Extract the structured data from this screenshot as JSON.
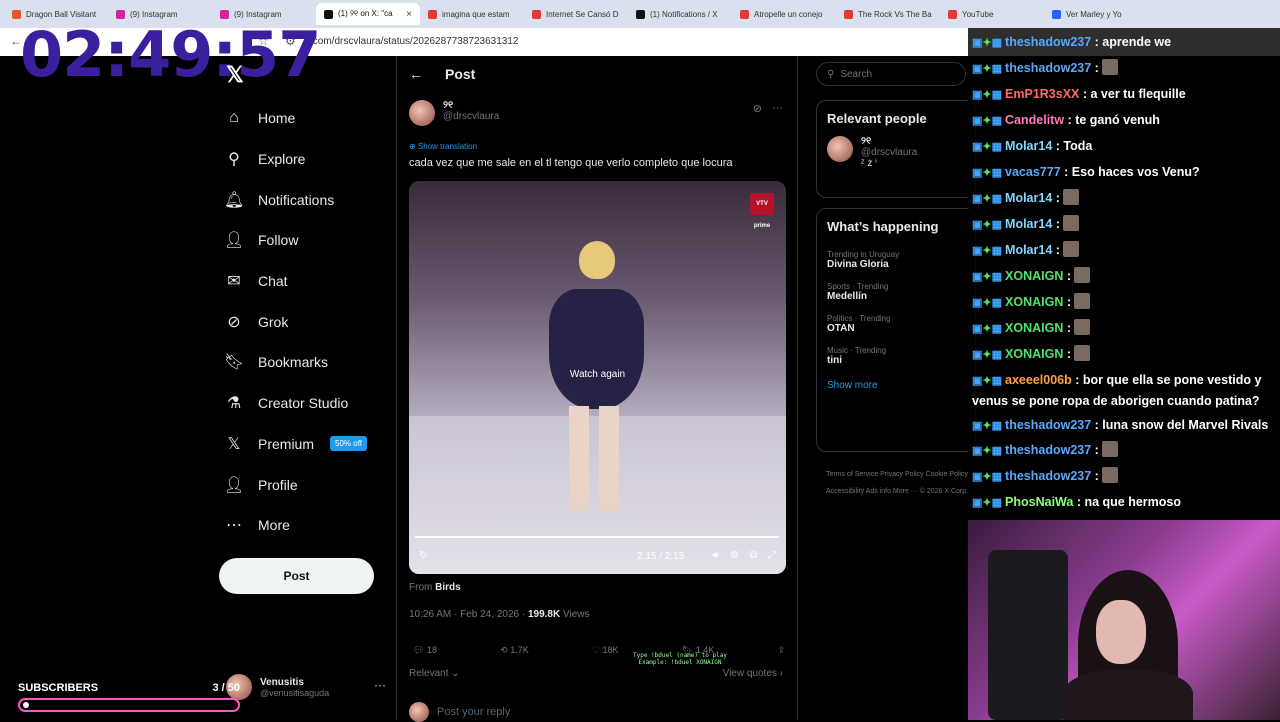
{
  "browser": {
    "tabs": [
      {
        "title": "Dragon Ball Visitant",
        "color": "#e8572a"
      },
      {
        "title": "(9) Instagram",
        "color": "#d6249f"
      },
      {
        "title": "(9) Instagram",
        "color": "#d6249f"
      },
      {
        "title": "(1) ୨୧ on X: \"ca",
        "color": "#111111",
        "active": true
      },
      {
        "title": "imagina que estam",
        "color": "#e53935"
      },
      {
        "title": "Internet Se Cansó D",
        "color": "#e53935"
      },
      {
        "title": "(1) Notifications / X",
        "color": "#111111"
      },
      {
        "title": "Atropelle un conejo",
        "color": "#e53935"
      },
      {
        "title": "The Rock Vs The Ba",
        "color": "#e53935"
      },
      {
        "title": "YouTube",
        "color": "#e53935"
      },
      {
        "title": "Ver Marley y Yo",
        "color": "#2962ff"
      }
    ],
    "url": "x.com/drscvlaura/status/2026287738723631312"
  },
  "stream": {
    "timer": "02:49:57",
    "subscribers_label": "SUBSCRIBERS",
    "subscribers_count": "3 / 50",
    "subscribers_fraction": 0.06
  },
  "sidebar": {
    "items": [
      {
        "label": "Home",
        "icon": "home-icon",
        "glyph": "⌂"
      },
      {
        "label": "Explore",
        "icon": "search-icon",
        "glyph": "⚲"
      },
      {
        "label": "Notifications",
        "icon": "bell-icon",
        "glyph": "🔔︎"
      },
      {
        "label": "Follow",
        "icon": "add-user-icon",
        "glyph": "👤︎"
      },
      {
        "label": "Chat",
        "icon": "mail-icon",
        "glyph": "✉"
      },
      {
        "label": "Grok",
        "icon": "grok-icon",
        "glyph": "⊘"
      },
      {
        "label": "Bookmarks",
        "icon": "bookmark-icon",
        "glyph": "🔖︎"
      },
      {
        "label": "Creator Studio",
        "icon": "flask-icon",
        "glyph": "⚗"
      },
      {
        "label": "Premium",
        "icon": "x-icon",
        "glyph": "𝕏"
      },
      {
        "label": "Profile",
        "icon": "person-icon",
        "glyph": "👤︎"
      },
      {
        "label": "More",
        "icon": "more-circle-icon",
        "glyph": "⋯"
      }
    ],
    "premium_badge": "50% off",
    "post_button": "Post",
    "account_name": "Venusitis",
    "account_handle": "@venusitisaguda"
  },
  "post": {
    "header": "Post",
    "author_name": "୨୧",
    "author_handle": "@drscvlaura",
    "show_translation": "Show translation",
    "text": "cada vez que me sale en el tl tengo que verlo completo que locura",
    "video_logo": "VTV prime",
    "watch_again": "Watch again",
    "video_time": "2:15 / 2:15",
    "from_label": "From",
    "from_source": "Birds",
    "timestamp": "10:26 AM · Feb 24, 2026 ·",
    "views_count": "199.8K",
    "views_label": "Views",
    "replies": "18",
    "reposts": "1.7K",
    "likes": "18K",
    "bookmarks": "1.4K",
    "sort_label": "Relevant",
    "view_quotes": "View quotes",
    "reply_placeholder": "Post your reply",
    "game_overlay_line1": "Type !bduel (name) to play",
    "game_overlay_line2": "Example: !bduel XONAIGN"
  },
  "right": {
    "search_placeholder": "Search",
    "relevant_title": "Relevant people",
    "person_name": "୨୧",
    "person_handle": "@drscvlaura",
    "person_bio": "ᶻ z ⁱ",
    "happening_title": "What’s happening",
    "trends": [
      {
        "label": "Trending in Uruguay",
        "name": "Divina Gloria"
      },
      {
        "label": "Sports · Trending",
        "name": "Medellín"
      },
      {
        "label": "Politics · Trending",
        "name": "OTAN"
      },
      {
        "label": "Music · Trending",
        "name": "tini"
      }
    ],
    "show_more": "Show more",
    "footer_line1": "Terms of Service   Privacy Policy   Cookie Policy",
    "footer_line2": "Accessibility   Ads info   More ···   © 2026 X Corp."
  },
  "chat": {
    "messages": [
      {
        "user": "theshadow237",
        "color": "#5aa9ff",
        "text": ": aprende we"
      },
      {
        "user": "theshadow237",
        "color": "#5aa9ff",
        "text": ":",
        "emote": true
      },
      {
        "user": "EmP1R3sXX",
        "color": "#ff6b6b",
        "text": ": a ver tu flequille"
      },
      {
        "user": "Candelitw",
        "color": "#ff7ab6",
        "text": ": te ganó venuh"
      },
      {
        "user": "Molar14",
        "color": "#7fd6ff",
        "text": ": Toda"
      },
      {
        "user": "vacas777",
        "color": "#5aa9ff",
        "text": ": Eso haces vos Venu?"
      },
      {
        "user": "Molar14",
        "color": "#7fd6ff",
        "text": ":",
        "emote": true
      },
      {
        "user": "Molar14",
        "color": "#7fd6ff",
        "text": ":",
        "emote": true
      },
      {
        "user": "Molar14",
        "color": "#7fd6ff",
        "text": ":",
        "emote": true
      },
      {
        "user": "XONAIGN",
        "color": "#4fe36a",
        "text": ":",
        "emote": true
      },
      {
        "user": "XONAIGN",
        "color": "#4fe36a",
        "text": ":",
        "emote": true
      },
      {
        "user": "XONAIGN",
        "color": "#4fe36a",
        "text": ":",
        "emote": true
      },
      {
        "user": "XONAIGN",
        "color": "#4fe36a",
        "text": ":",
        "emote": true
      },
      {
        "user": "axeeel006b",
        "color": "#ff9f43",
        "text": ": bor que ella se pone vestido y venus se pone ropa de aborigen cuando patina?",
        "wrap": true
      },
      {
        "user": "theshadow237",
        "color": "#5aa9ff",
        "text": ": luna snow del Marvel Rivals",
        "wrap": true
      },
      {
        "user": "theshadow237",
        "color": "#5aa9ff",
        "text": ":",
        "emote": true
      },
      {
        "user": "theshadow237",
        "color": "#5aa9ff",
        "text": ":",
        "emote": true
      },
      {
        "user": "PhosNaiWa",
        "color": "#8cff7a",
        "text": ": na que hermoso"
      }
    ]
  }
}
